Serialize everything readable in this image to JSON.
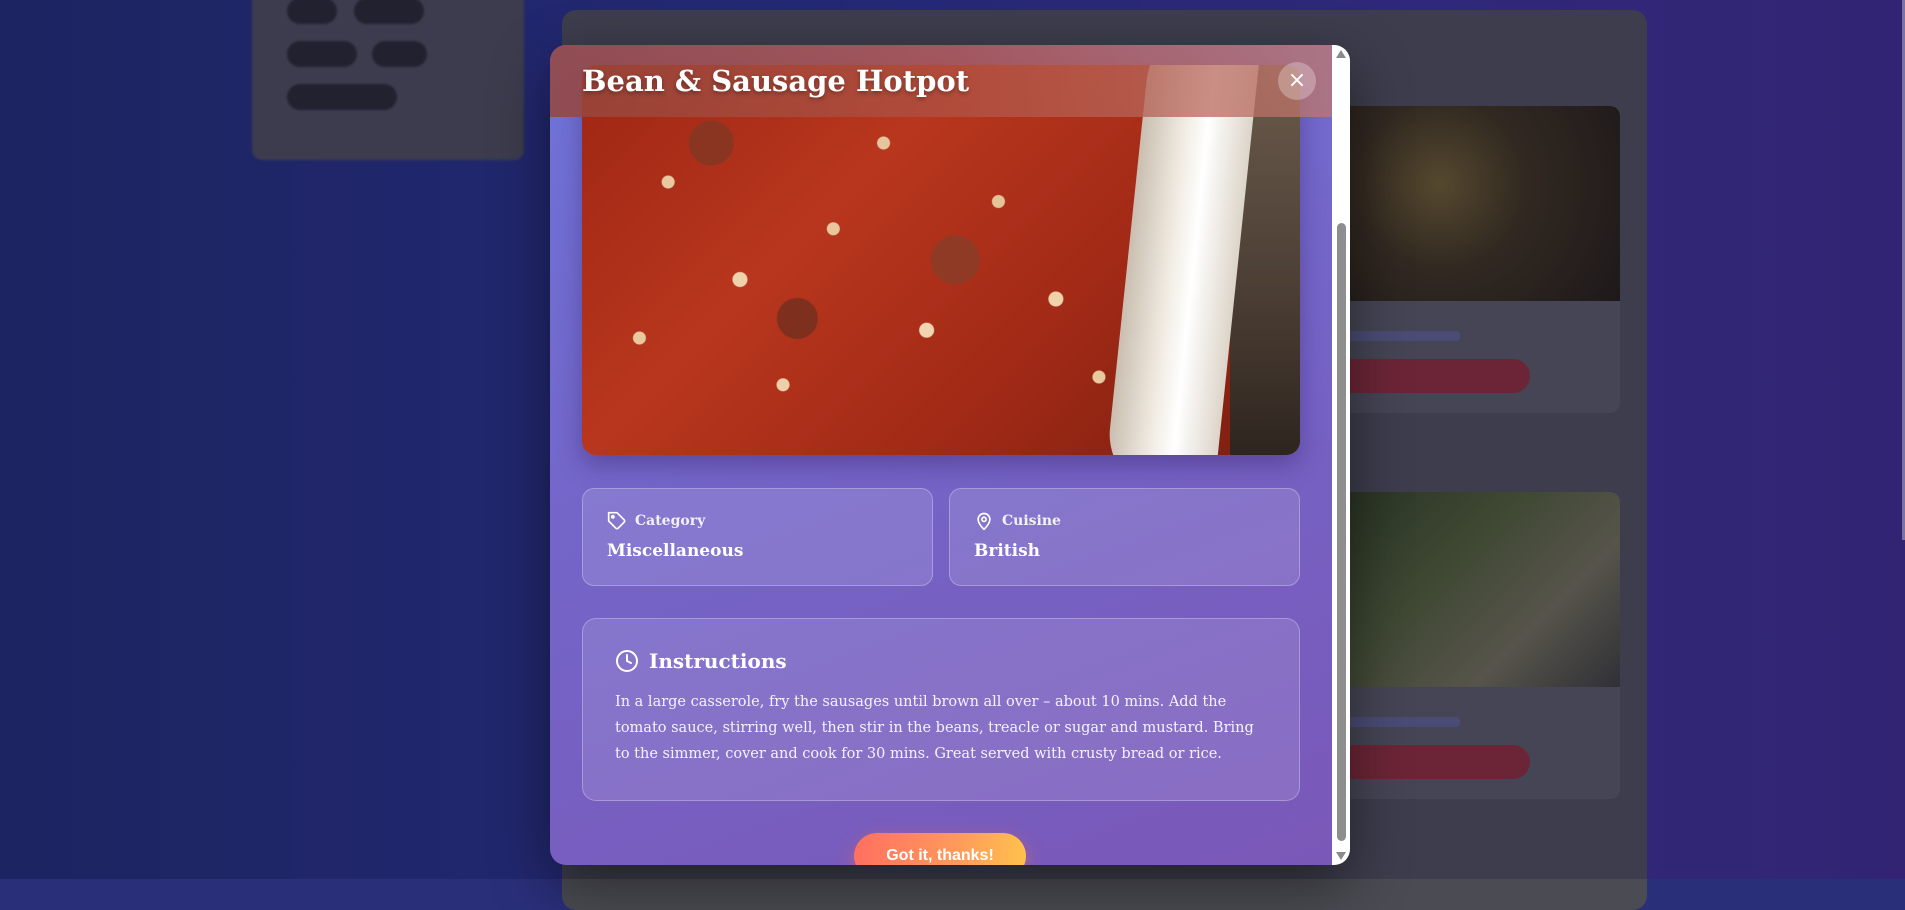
{
  "modal": {
    "title": "Bean & Sausage Hotpot",
    "close_label": "×",
    "hero_image": "bean-and-sausage-hotpot-photo",
    "category": {
      "label": "Category",
      "value": "Miscellaneous",
      "icon": "tag-icon"
    },
    "cuisine": {
      "label": "Cuisine",
      "value": "British",
      "icon": "map-pin-icon"
    },
    "instructions": {
      "heading": "Instructions",
      "icon": "clock-icon",
      "text": "In a large casserole, fry the sausages until brown all over – about 10 mins. Add the tomato sauce, stirring well, then stir in the beans, treacle or sugar and mustard. Bring to the simmer, cover and cook for 30 mins. Great served with crusty bread or rice."
    },
    "confirm_label": "Got it, thanks!"
  },
  "colors": {
    "modal_gradient_start": "#6f73d8",
    "modal_gradient_end": "#7a58b8",
    "button_gradient_start": "#ff6f61",
    "button_gradient_end": "#ffc14d"
  }
}
